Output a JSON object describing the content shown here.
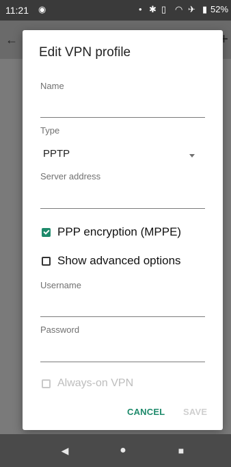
{
  "status_bar": {
    "time": "11:21",
    "battery_text": "52%"
  },
  "dialog": {
    "title": "Edit VPN profile",
    "name": {
      "label": "Name",
      "value": ""
    },
    "type": {
      "label": "Type",
      "selected": "PPTP"
    },
    "server": {
      "label": "Server address",
      "value": ""
    },
    "ppp_encryption": {
      "label": "PPP encryption (MPPE)",
      "checked": true
    },
    "advanced": {
      "label": "Show advanced options",
      "checked": false
    },
    "username": {
      "label": "Username",
      "value": ""
    },
    "password": {
      "label": "Password",
      "value": ""
    },
    "always_on": {
      "label": "Always-on VPN",
      "checked": false,
      "enabled": false
    },
    "buttons": {
      "cancel": "CANCEL",
      "save": "SAVE"
    }
  },
  "colors": {
    "accent": "#1e8a6b"
  }
}
